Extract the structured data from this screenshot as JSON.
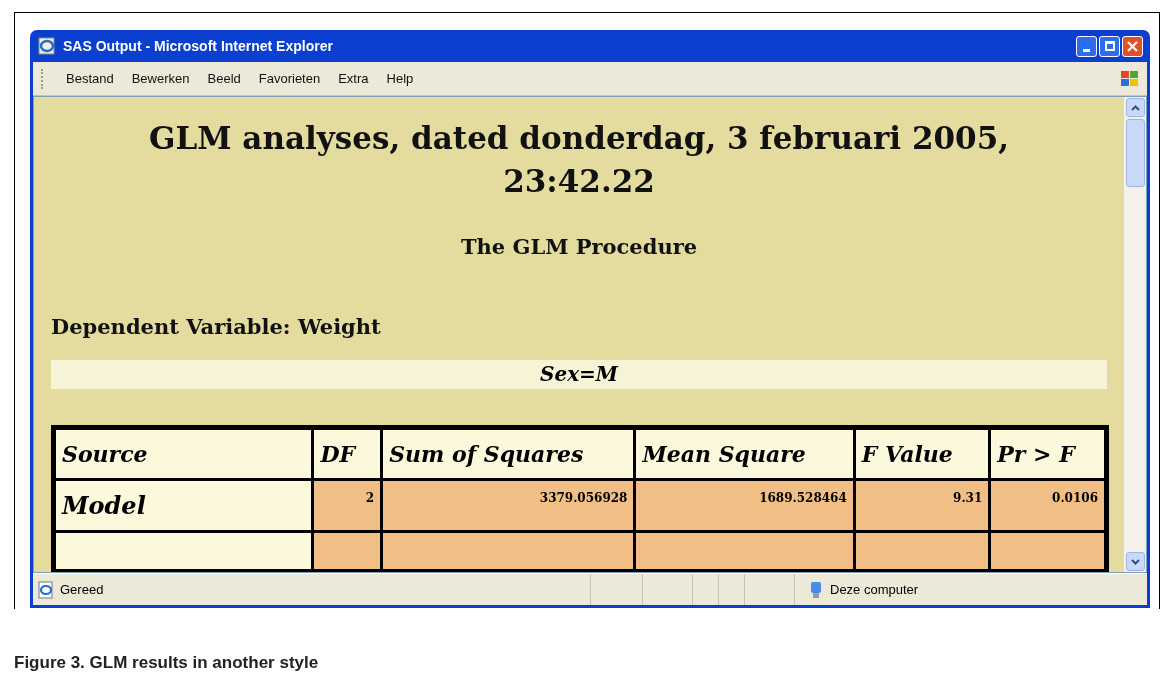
{
  "window": {
    "title": "SAS Output - Microsoft Internet Explorer"
  },
  "menu": [
    "Bestand",
    "Bewerken",
    "Beeld",
    "Favorieten",
    "Extra",
    "Help"
  ],
  "page": {
    "title": "GLM analyses, dated donderdag, 3 februari 2005, 23:42.22",
    "procedure": "The GLM Procedure",
    "dependent": "Dependent Variable: Weight",
    "by_group": "Sex=M",
    "table": {
      "columns": [
        "Source",
        "DF",
        "Sum of Squares",
        "Mean Square",
        "F Value",
        "Pr > F"
      ],
      "rows": [
        {
          "cells": [
            "Model",
            "2",
            "3379.056928",
            "1689.528464",
            "9.31",
            "0.0106"
          ]
        }
      ]
    }
  },
  "status_bar": {
    "text": "Gereed",
    "zone": "Deze computer"
  },
  "caption": "Figure 3. GLM results in another style"
}
